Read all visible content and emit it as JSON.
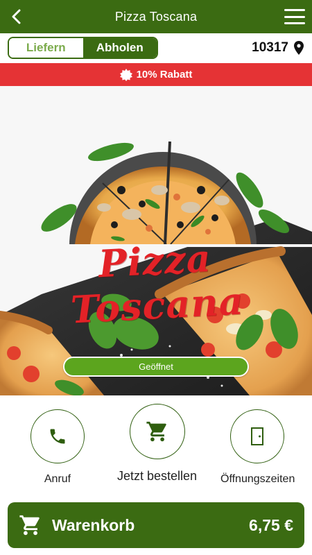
{
  "header": {
    "title": "Pizza Toscana",
    "back_icon": "chevron-left-icon",
    "menu_icon": "hamburger-menu-icon"
  },
  "mode_toggle": {
    "options": [
      {
        "label": "Liefern",
        "active": false
      },
      {
        "label": "Abholen",
        "active": true
      }
    ]
  },
  "location": {
    "postal_code": "10317",
    "icon": "map-pin-icon"
  },
  "promo": {
    "icon": "badge-icon",
    "text": "10% Rabatt"
  },
  "hero": {
    "logo_text": "Pizza Toscana",
    "status": "Geöffnet"
  },
  "actions": [
    {
      "label": "Anruf",
      "icon": "phone-icon"
    },
    {
      "label": "Jetzt bestellen",
      "icon": "shopping-cart-icon"
    },
    {
      "label": "Öffnungszeiten",
      "icon": "door-icon"
    }
  ],
  "cart": {
    "label": "Warenkorb",
    "total": "6,75 €",
    "icon": "shopping-cart-icon"
  },
  "colors": {
    "primary_green": "#3b6b12",
    "light_green": "#7bab4c",
    "status_green": "#5ca51e",
    "promo_red": "#e53335",
    "logo_red": "#e32227"
  }
}
